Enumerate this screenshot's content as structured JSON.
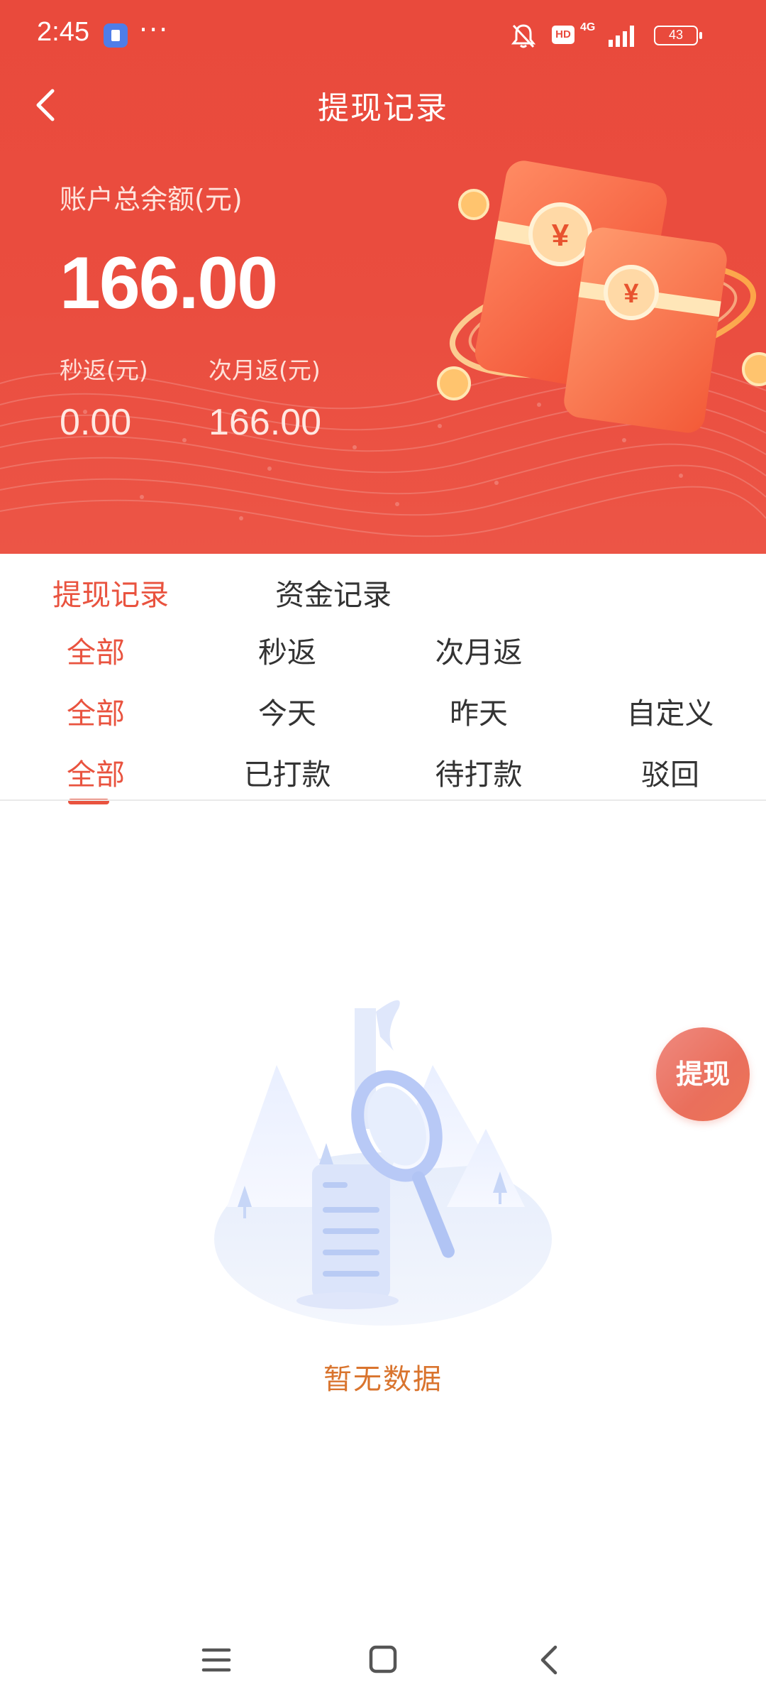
{
  "status_bar": {
    "time": "2:45",
    "dots": "···",
    "hd": "HD",
    "network": "4G",
    "battery": "43"
  },
  "nav": {
    "title": "提现记录"
  },
  "balance": {
    "label": "账户总余额(元)",
    "value": "166.00",
    "instant_label": "秒返(元)",
    "instant_value": "0.00",
    "next_month_label": "次月返(元)",
    "next_month_value": "166.00"
  },
  "tabs": {
    "primary": [
      {
        "label": "提现记录",
        "active": true
      },
      {
        "label": "资金记录",
        "active": false
      }
    ],
    "type_filter": [
      {
        "label": "全部",
        "active": true
      },
      {
        "label": "秒返",
        "active": false
      },
      {
        "label": "次月返",
        "active": false
      }
    ],
    "date_filter": [
      {
        "label": "全部",
        "active": true
      },
      {
        "label": "今天",
        "active": false
      },
      {
        "label": "昨天",
        "active": false
      },
      {
        "label": "自定义",
        "active": false
      }
    ],
    "status_filter": [
      {
        "label": "全部",
        "active": true
      },
      {
        "label": "已打款",
        "active": false
      },
      {
        "label": "待打款",
        "active": false
      },
      {
        "label": "驳回",
        "active": false
      }
    ]
  },
  "empty_state": {
    "text": "暂无数据"
  },
  "fab": {
    "label": "提现"
  },
  "colors": {
    "header_red": "#e94a3c",
    "accent": "#e9533f",
    "empty_text": "#d9742e"
  },
  "icons": [
    "back-arrow-icon",
    "mute-icon",
    "signal-icon",
    "battery-icon",
    "menu-icon",
    "home-icon",
    "back-icon"
  ]
}
